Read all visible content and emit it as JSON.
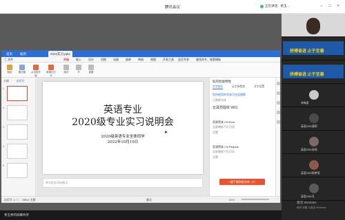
{
  "meeting": {
    "app_title": "腾讯会议",
    "speaking_label": "正在讲话：余玉...",
    "bottom_label": "余玉秀的屏幕共享"
  },
  "wps": {
    "tabs": [
      "首页",
      "稻壳",
      "2022实习.pptx"
    ],
    "menus": [
      "三 文件",
      "开始",
      "插入",
      "设计",
      "切换",
      "动画",
      "放映",
      "审阅",
      "视图",
      "开发工具",
      "会员专享",
      "查找命令、搜索模板"
    ],
    "ribbon": [
      "粘贴",
      "格式刷",
      "从当前开始",
      "新建幻灯片",
      "版式",
      "节",
      "重置"
    ],
    "panes": {
      "outline": "大纲",
      "slides": "幻灯片"
    },
    "thumb_numbers": [
      "1",
      "2",
      "3",
      "4",
      "5"
    ],
    "slide": {
      "title1": "英语专业",
      "title2": "2020级专业实习说明会",
      "line1": "2020级英语专业全体同学",
      "line2": "2022年10月19日"
    },
    "notes_placeholder": "单击此处添加备注",
    "right_panel": {
      "title": "稻壳智能特性",
      "tabs": [
        "文字批注",
        "云字体检测",
        "文字设置"
      ],
      "hint": "您所使用的字体可在此替换",
      "section": "已替换字体",
      "items": [
        {
          "name": "仓耳舒圆体 W01",
          "sub": ""
        },
        {
          "name": "思源黑体 CN Bold",
          "sub": "全屏播放下仍可用"
        },
        {
          "name": "思源黑体 CN Regular",
          "sub": "全屏播放下仍可用"
        }
      ],
      "set_label": "设置",
      "button": "一键下载利用字体（3）"
    },
    "status": {
      "page": "幻灯片 1 / 7",
      "theme": "Office 主题",
      "notes": "备注",
      "zoom": "63%"
    }
  },
  "participants": [
    {
      "name": "",
      "kind": "camera"
    },
    {
      "name": "拼搏奋进 止于至善",
      "kind": "banner"
    },
    {
      "name": "拼搏奋进 止于至善",
      "kind": "banner"
    },
    {
      "name": "李梅丽",
      "kind": "avatar"
    },
    {
      "name": "英语2001唐莉",
      "kind": "avatar"
    },
    {
      "name": "英语2001张瑶",
      "kind": "avatar"
    },
    {
      "name": "英语2001杨梦瑶",
      "kind": "avatar"
    },
    {
      "name": "英语2001孔",
      "kind": "avatar"
    }
  ],
  "watermark": {
    "line1": "激活 Windows",
    "line2": "转到\"设置\"以激活 Windows。"
  }
}
